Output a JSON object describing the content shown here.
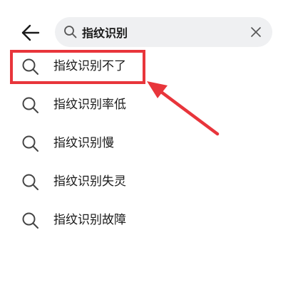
{
  "search": {
    "query": "指纹识别"
  },
  "suggestions": [
    {
      "label": "指纹识别不了"
    },
    {
      "label": "指纹识别率低"
    },
    {
      "label": "指纹识别慢"
    },
    {
      "label": "指纹识别失灵"
    },
    {
      "label": "指纹识别故障"
    }
  ],
  "colors": {
    "highlight": "#e8353b",
    "search_bg": "#eff0f2",
    "icon": "#444444"
  },
  "icons": {
    "back": "arrow-left-icon",
    "search": "search-icon",
    "clear": "close-icon"
  }
}
